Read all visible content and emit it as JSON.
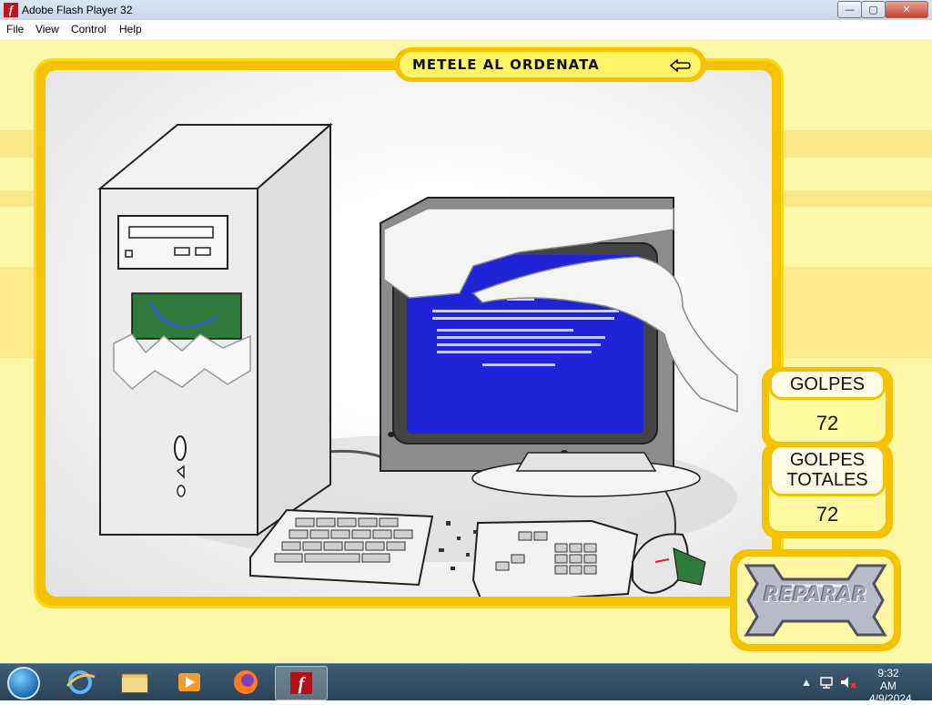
{
  "window": {
    "title": "Adobe Flash Player 32",
    "app_icon_glyph": "f",
    "minimize_glyph": "—",
    "maximize_glyph": "▢",
    "close_glyph": "✕"
  },
  "menu": {
    "items": [
      {
        "label": "File"
      },
      {
        "label": "View"
      },
      {
        "label": "Control"
      },
      {
        "label": "Help"
      }
    ]
  },
  "game": {
    "title": "METELE AL ORDENATA",
    "golpes_label": "GOLPES",
    "golpes_value": "72",
    "golpes_totales_label_line1": "GOLPES",
    "golpes_totales_label_line2": "TOTALES",
    "golpes_totales_value": "72",
    "repair_button": "REPARAR",
    "screen_color": "#1f25d6",
    "accent": "#f5c200"
  },
  "taskbar": {
    "items": [
      {
        "icon": "start-orb"
      },
      {
        "icon": "internet-explorer-icon"
      },
      {
        "icon": "file-explorer-icon"
      },
      {
        "icon": "media-player-icon"
      },
      {
        "icon": "firefox-icon"
      },
      {
        "icon": "flash-player-icon"
      }
    ],
    "time": "9:32 AM",
    "date": "4/9/2024"
  }
}
